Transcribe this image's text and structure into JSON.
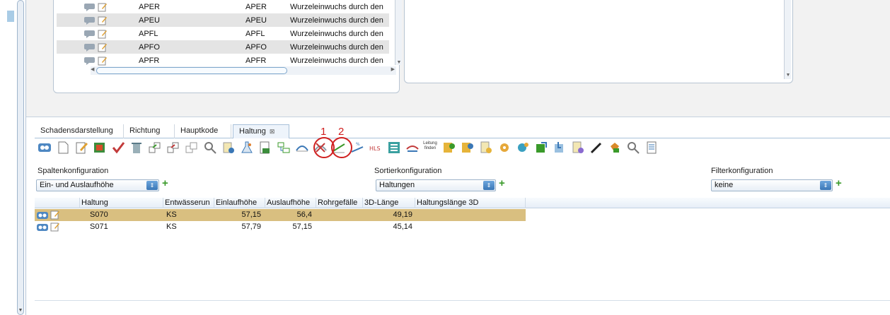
{
  "list_rows": [
    {
      "code": "APER",
      "short": "APER",
      "desc": "Wurzeleinwuchs durch den"
    },
    {
      "code": "APEU",
      "short": "APEU",
      "desc": "Wurzeleinwuchs durch den"
    },
    {
      "code": "APFL",
      "short": "APFL",
      "desc": "Wurzeleinwuchs durch den"
    },
    {
      "code": "APFO",
      "short": "APFO",
      "desc": "Wurzeleinwuchs durch den"
    },
    {
      "code": "APFR",
      "short": "APFR",
      "desc": "Wurzeleinwuchs durch den"
    }
  ],
  "tabs": [
    {
      "label": "Schadensdarstellung"
    },
    {
      "label": "Richtung"
    },
    {
      "label": "Hauptkode"
    },
    {
      "label": "Haltung",
      "close": "⊠"
    }
  ],
  "toolbar": {
    "leitung_label": "Leitung finden",
    "annotation_1": "1",
    "annotation_2": "2"
  },
  "config": {
    "spalten_label": "Spaltenkonfiguration",
    "spalten_value": "Ein- und Auslaufhöhe",
    "sortier_label": "Sortierkonfiguration",
    "sortier_value": "Haltungen",
    "filter_label": "Filterkonfiguration",
    "filter_value": "keine"
  },
  "table": {
    "headers": [
      "Haltung",
      "Entwässerun",
      "Einlaufhöhe",
      "Auslaufhöhe",
      "Rohrgefälle",
      "3D-Länge",
      "Haltungslänge 3D"
    ],
    "rows": [
      {
        "haltung": "S070",
        "entw": "KS",
        "einlauf": "57,15",
        "auslauf": "56,4",
        "gefaelle": "",
        "laenge3d": "49,19",
        "hlaenge": ""
      },
      {
        "haltung": "S071",
        "entw": "KS",
        "einlauf": "57,79",
        "auslauf": "57,15",
        "gefaelle": "",
        "laenge3d": "45,14",
        "hlaenge": ""
      }
    ]
  },
  "colors": {
    "selected_row": "#d9bf80",
    "annotation": "#d02020",
    "accent_blue": "#3a77b6"
  }
}
